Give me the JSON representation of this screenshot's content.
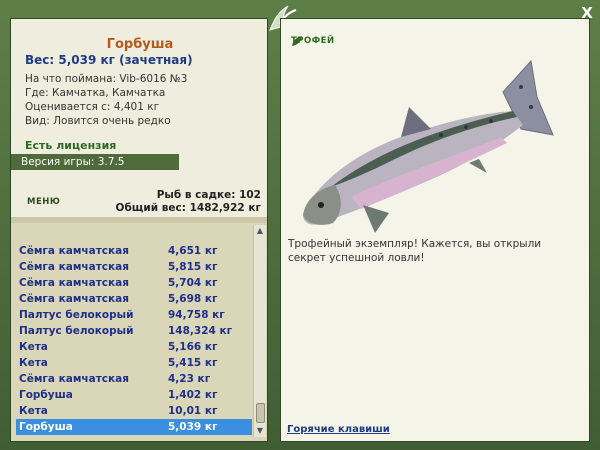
{
  "window": {
    "close_label": "X"
  },
  "catch": {
    "name": "Горбуша",
    "weight": "Вес: 5,039 кг (зачетная)",
    "bait": "На что поймана: Vib-6016 №3",
    "location": "Где: Камчатка, Камчатка",
    "value": "Оценивается с: 4,401 кг",
    "rarity": "Вид: Ловится очень редко"
  },
  "license": "Есть лицензия",
  "version": "Версия игры: 3.7.5",
  "menu_label": "МЕНЮ",
  "stats": {
    "fish_count": "Рыб в садке: 102",
    "total_weight": "Общий вес: 1482,922 кг"
  },
  "fish_list": [
    {
      "name": "Сёмга камчатская",
      "weight": "4,651 кг"
    },
    {
      "name": "Сёмга камчатская",
      "weight": "5,815 кг"
    },
    {
      "name": "Сёмга камчатская",
      "weight": "5,704 кг"
    },
    {
      "name": "Сёмга камчатская",
      "weight": "5,698 кг"
    },
    {
      "name": "Палтус белокорый",
      "weight": "94,758 кг"
    },
    {
      "name": "Палтус белокорый",
      "weight": "148,324 кг"
    },
    {
      "name": "Кета",
      "weight": "5,166 кг"
    },
    {
      "name": "Кета",
      "weight": "5,415 кг"
    },
    {
      "name": "Сёмга камчатская",
      "weight": "4,23 кг"
    },
    {
      "name": "Горбуша",
      "weight": "1,402 кг"
    },
    {
      "name": "Кета",
      "weight": "10,01 кг"
    },
    {
      "name": "Горбуша",
      "weight": "5,039 кг"
    }
  ],
  "selected_index": 11,
  "trophy": {
    "title": "ТРОФЕЙ",
    "text": "Трофейный экземпляр! Кажется, вы открыли секрет успешной ловли!"
  },
  "hotkeys_link": "Горячие клавиши",
  "colors": {
    "accent": "#b55a1d",
    "selected": "#3b8fe0",
    "frame": "#4b6b3c"
  }
}
